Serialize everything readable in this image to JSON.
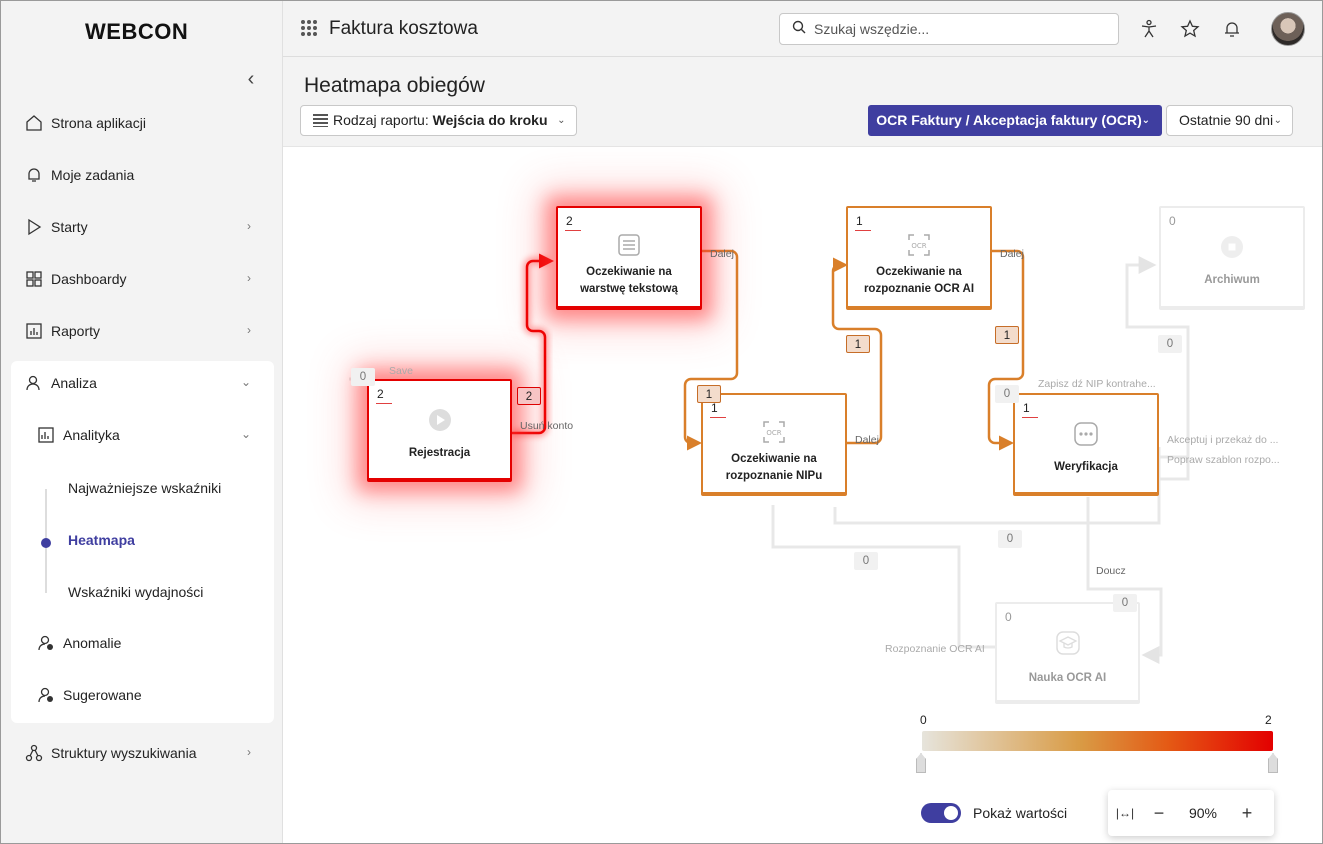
{
  "brand": {
    "logo": "WEBCON"
  },
  "sidebar": {
    "items": [
      {
        "label": "Strona aplikacji",
        "icon": "home-icon",
        "chevron": false
      },
      {
        "label": "Moje zadania",
        "icon": "bell-icon",
        "chevron": false
      },
      {
        "label": "Starty",
        "icon": "play-icon",
        "chevron": true
      },
      {
        "label": "Dashboardy",
        "icon": "dashboard-icon",
        "chevron": true
      },
      {
        "label": "Raporty",
        "icon": "report-icon",
        "chevron": true
      },
      {
        "label": "Analiza",
        "icon": "analysis-icon",
        "chevron": true,
        "expanded": true
      },
      {
        "label": "Struktury wyszukiwania",
        "icon": "structure-icon",
        "chevron": true
      }
    ],
    "analiza": {
      "analityka": "Analityka",
      "subitems": [
        "Najważniejsze wskaźniki",
        "Heatmapa",
        "Wskaźniki wydajności"
      ],
      "active": "Heatmapa",
      "anomalie": "Anomalie",
      "sugerowane": "Sugerowane"
    }
  },
  "topbar": {
    "app_title": "Faktura kosztowa",
    "search_placeholder": "Szukaj wszędzie..."
  },
  "page": {
    "title": "Heatmapa obiegów",
    "report_type_label": "Rodzaj raportu:",
    "report_type_value": "Wejścia do kroku",
    "process": "OCR Faktury / Akceptacja faktury (OCR)",
    "period": "Ostatnie 90 dni"
  },
  "heatmap": {
    "nodes": {
      "rejestracja": {
        "count": "2",
        "label": "Rejestracja"
      },
      "warstwa": {
        "count": "2",
        "label": "Oczekiwanie na warstwę tekstową"
      },
      "nipu": {
        "count": "1",
        "label": "Oczekiwanie na rozpoznanie NIPu"
      },
      "ocrai": {
        "count": "1",
        "label": "Oczekiwanie na rozpoznanie OCR AI"
      },
      "weryfikacja": {
        "count": "1",
        "label": "Weryfikacja"
      },
      "archiwum": {
        "count": "0",
        "label": "Archiwum"
      },
      "nauka": {
        "count": "0",
        "label": "Nauka OCR AI"
      }
    },
    "badges": {
      "save": "0",
      "usun": "2",
      "dalej_1": "1",
      "dalej_2": "1",
      "dalej_3": "1",
      "zapisz": "0",
      "akceptuj": "0",
      "popraw": "0",
      "doucz": "0",
      "rozpoznanie": "0"
    },
    "edge_labels": {
      "save": "Save",
      "usun": "Usuń konto",
      "dalej_a": "Dalej",
      "dalej_b": "Dalej",
      "dalej_c": "Dalej",
      "zapisz": "Zapisz dź NIP kontrahe...",
      "akceptuj": "Akceptuj i przekaż do ...",
      "popraw": "Popraw szablon rozpo...",
      "doucz": "Doucz",
      "rozpoznanie": "Rozpoznanie OCR AI"
    },
    "legend": {
      "min": "0",
      "max": "2"
    },
    "toggle_label": "Pokaż wartości",
    "zoom": "90%"
  },
  "colors": {
    "accent": "#3f3ea0",
    "hot": "#e40000",
    "warm": "#d97f2a",
    "cold": "#e6e4dc"
  }
}
